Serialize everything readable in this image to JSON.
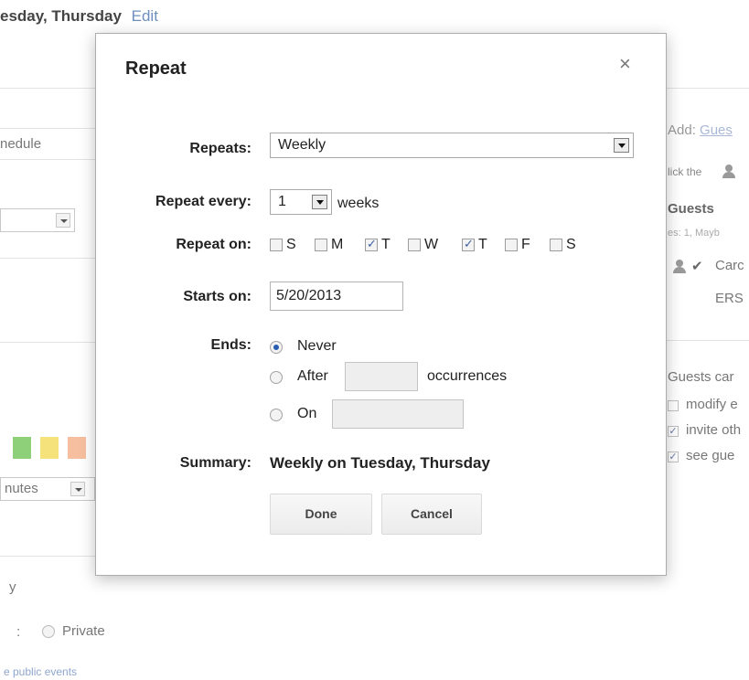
{
  "background": {
    "header_text": "esday, Thursday",
    "header_edit": "Edit",
    "schedule_tab": "nedule",
    "minutes_select": "nutes",
    "visibility_label": "y",
    "private_label": "Private",
    "colon": ":",
    "public_events_link": "e public events",
    "right_panel": {
      "add_label": "Add:",
      "guests_link": "Gues",
      "click_text": "lick the",
      "guests_heading": "Guests",
      "rsvp_counts": "es: 1, Mayb",
      "checkmark": "✔",
      "guest_name": "Carc",
      "guest_sub": "ERS",
      "guests_can": "Guests car",
      "perm_modify": "modify e",
      "perm_invite": "invite oth",
      "perm_see": "see gue",
      "perm_invite_checked": true,
      "perm_see_checked": true
    },
    "swatch_colors": [
      "#8ecf7a",
      "#f5e27a",
      "#f6bfa0"
    ]
  },
  "dialog": {
    "title": "Repeat",
    "close_glyph": "×",
    "repeats_label": "Repeats:",
    "repeats_value": "Weekly",
    "repeat_every_label": "Repeat every:",
    "repeat_every_value": "1",
    "repeat_every_unit": "weeks",
    "repeat_on_label": "Repeat on:",
    "days": [
      {
        "label": "S",
        "checked": false
      },
      {
        "label": "M",
        "checked": false
      },
      {
        "label": "T",
        "checked": true
      },
      {
        "label": "W",
        "checked": false
      },
      {
        "label": "T",
        "checked": true
      },
      {
        "label": "F",
        "checked": false
      },
      {
        "label": "S",
        "checked": false
      }
    ],
    "starts_on_label": "Starts on:",
    "starts_on_value": "5/20/2013",
    "ends_label": "Ends:",
    "ends_never": "Never",
    "ends_after": "After",
    "ends_after_value": "",
    "ends_occurrences": "occurrences",
    "ends_on": "On",
    "ends_on_value": "",
    "ends_selected": "Never",
    "summary_label": "Summary:",
    "summary_value": "Weekly on Tuesday, Thursday",
    "done_label": "Done",
    "cancel_label": "Cancel"
  }
}
